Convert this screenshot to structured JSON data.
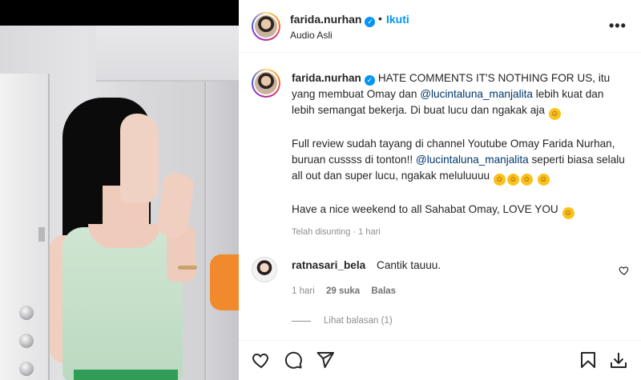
{
  "post": {
    "username": "farida.nurhan",
    "follow_label": "Ikuti",
    "separator": "•",
    "audio_label": "Audio Asli",
    "more_label": "•••"
  },
  "caption": {
    "username": "farida.nurhan",
    "part1_a": "HATE COMMENTS IT'S NOTHING FOR US, itu yang membuat Omay dan ",
    "mention1": "@lucintaluna_manjalita",
    "part1_b": " lebih kuat dan lebih semangat bekerja. Di buat lucu dan ngakak aja",
    "part2_a": "Full review sudah tayang di channel Youtube Omay Farida Nurhan, buruan cussss di tonton!! ",
    "mention2": "@lucintaluna_manjalita",
    "part2_b": " seperti biasa selalu all out dan super lucu, ngakak meluluuuu",
    "part3": "Have a nice weekend to all Sahabat Omay, LOVE YOU",
    "edited_time": "Telah disunting · 1 hari"
  },
  "comment": {
    "username": "ratnasari_bela",
    "text": "Cantik tauuu.",
    "time": "1 hari",
    "likes": "29 suka",
    "reply_label": "Balas",
    "view_replies": "Lihat balasan (1)"
  },
  "icons": {
    "verified": "verified-badge-icon",
    "like": "heart-icon",
    "comment": "comment-icon",
    "share": "share-icon",
    "save": "bookmark-icon",
    "download": "download-icon"
  },
  "colors": {
    "accent": "#0095f6",
    "mention": "#00376b",
    "muted": "#8e8e8e"
  }
}
